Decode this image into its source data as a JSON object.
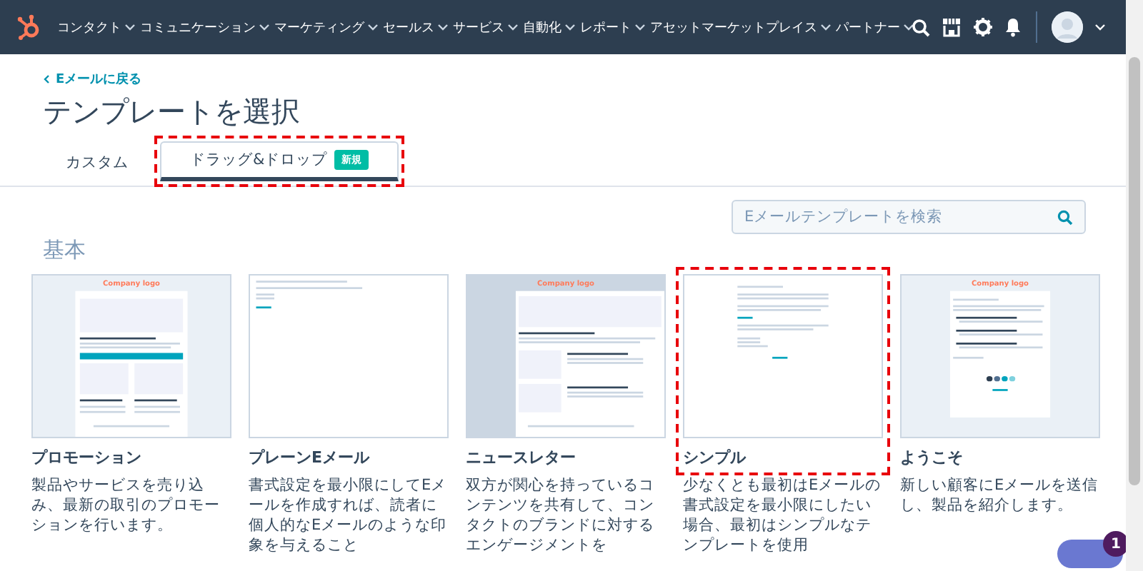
{
  "nav": {
    "items": [
      {
        "label": "コンタクト"
      },
      {
        "label": "コミュニケーション"
      },
      {
        "label": "マーケティング"
      },
      {
        "label": "セールス"
      },
      {
        "label": "サービス"
      },
      {
        "label": "自動化"
      },
      {
        "label": "レポート"
      },
      {
        "label": "アセットマーケットプレイス"
      },
      {
        "label": "パートナー"
      }
    ]
  },
  "header": {
    "back_link": "Eメールに戻る",
    "title": "テンプレートを選択"
  },
  "tabs": [
    {
      "label": "カスタム",
      "selected": false,
      "highlighted": false
    },
    {
      "label": "ドラッグ&ドロップ",
      "badge": "新規",
      "selected": true,
      "highlighted": true
    }
  ],
  "search": {
    "placeholder": "Eメールテンプレートを検索"
  },
  "section": {
    "title": "基本",
    "templates": [
      {
        "kind": "promo",
        "logo_text": "Company logo",
        "name": "プロモーション",
        "description": "製品やサービスを売り込み、最新の取引のプロモーションを行います。",
        "highlighted": false
      },
      {
        "kind": "plain",
        "name": "プレーンEメール",
        "description": "書式設定を最小限にしてEメールを作成すれば、読者に個人的なEメールのような印象を与えること",
        "highlighted": false
      },
      {
        "kind": "newsletter",
        "logo_text": "Company logo",
        "name": "ニュースレター",
        "description": "双方が関心を持っているコンテンツを共有して、コンタクトのブランドに対するエンゲージメントを",
        "highlighted": false
      },
      {
        "kind": "simple",
        "name": "シンプル",
        "description": "少なくとも最初はEメールの書式設定を最小限にしたい場合、最初はシンプルなテンプレートを使用",
        "highlighted": true
      },
      {
        "kind": "welcome",
        "logo_text": "Company logo",
        "name": "ようこそ",
        "description": "新しい顧客にEメールを送信し、製品を紹介します。",
        "highlighted": false
      }
    ]
  },
  "chat": {
    "badge": "1"
  }
}
